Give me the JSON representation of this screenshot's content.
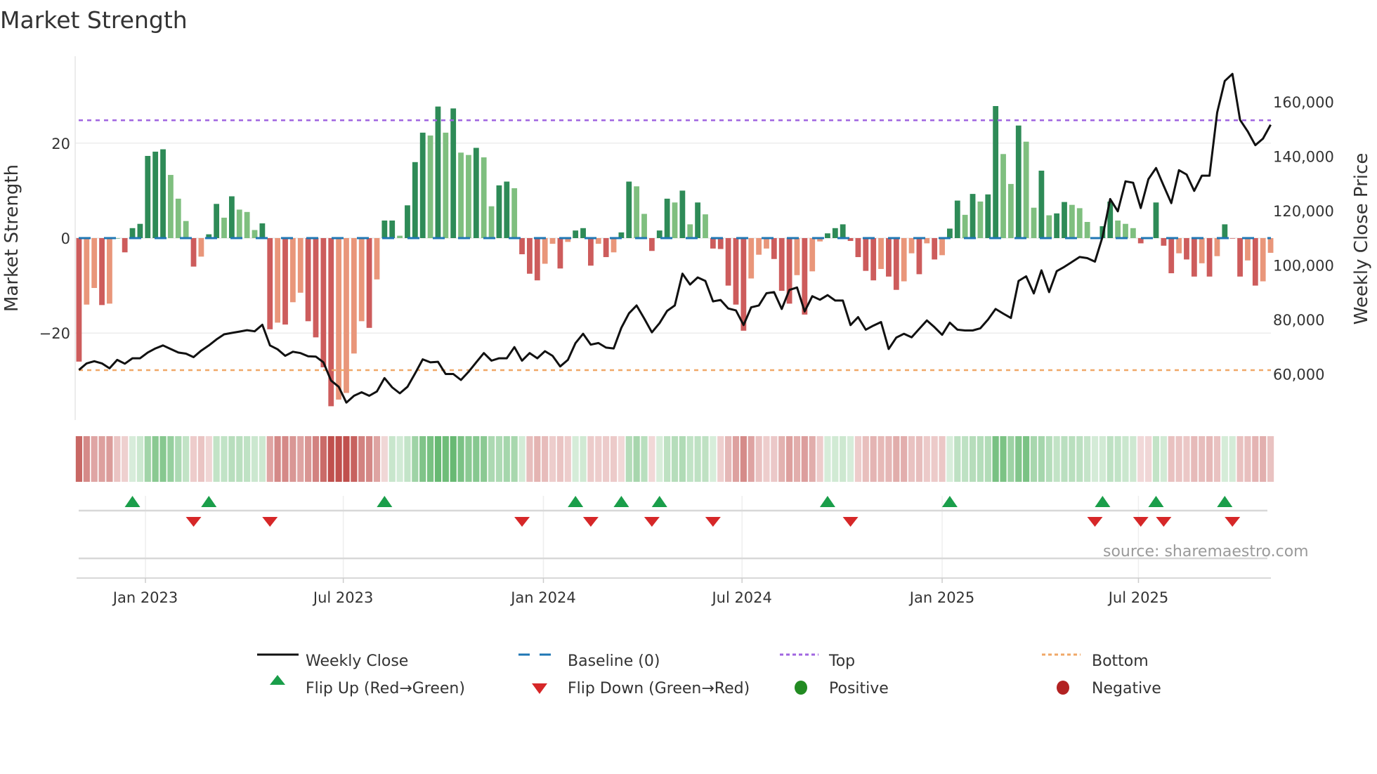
{
  "chart_data": {
    "type": "bar",
    "title": "Market Strength",
    "ylabel_left": "Market Strength",
    "ylabel_right": "Weekly Close Price",
    "ylim_left": [
      -38.3,
      38.3
    ],
    "ylim_right": [
      43100,
      176800
    ],
    "yticks_left": [
      {
        "value": 20,
        "label": "20"
      },
      {
        "value": 0,
        "label": "0"
      },
      {
        "value": -20,
        "label": "−20"
      }
    ],
    "yticks_right": [
      {
        "value": 60000,
        "label": "60,000"
      },
      {
        "value": 80000,
        "label": "80,000"
      },
      {
        "value": 100000,
        "label": "100,000"
      },
      {
        "value": 120000,
        "label": "120,000"
      },
      {
        "value": 140000,
        "label": "140,000"
      },
      {
        "value": 160000,
        "label": "160,000"
      }
    ],
    "xticks": [
      {
        "week": 9.7,
        "label": "Jan 2023"
      },
      {
        "week": 35.6,
        "label": "Jul 2023"
      },
      {
        "week": 61.8,
        "label": "Jan 2024"
      },
      {
        "week": 87.8,
        "label": "Jul 2024"
      },
      {
        "week": 114.0,
        "label": "Jan 2025"
      },
      {
        "week": 139.7,
        "label": "Jul 2025"
      }
    ],
    "top_level": 24.8,
    "bottom_level": -27.8,
    "baseline": 0,
    "strength": [
      -26.0,
      -14.0,
      -10.5,
      -14.1,
      -13.8,
      0,
      -3.0,
      2.1,
      3.0,
      17.3,
      18.2,
      18.7,
      13.3,
      8.3,
      3.6,
      -6.0,
      -3.9,
      0.8,
      7.2,
      4.3,
      8.8,
      6.0,
      5.5,
      1.7,
      3.1,
      -19.2,
      -17.8,
      -18.2,
      -13.5,
      -11.5,
      -17.5,
      -20.9,
      -27.2,
      -35.4,
      -34.0,
      -32.6,
      -24.3,
      -17.5,
      -18.9,
      -8.7,
      3.7,
      3.7,
      0.5,
      6.9,
      16.0,
      22.2,
      21.6,
      27.7,
      22.2,
      27.3,
      18.0,
      17.5,
      19.0,
      17.0,
      6.7,
      11.1,
      11.9,
      10.5,
      -3.4,
      -7.5,
      -8.9,
      -5.4,
      -1.2,
      -6.4,
      -0.8,
      1.6,
      2.1,
      -5.8,
      -1.2,
      -4.0,
      -3.0,
      1.2,
      11.9,
      10.9,
      5.1,
      -2.7,
      1.6,
      8.3,
      7.5,
      10.0,
      2.9,
      7.5,
      5.0,
      -2.2,
      -2.3,
      -10.0,
      -14.0,
      -19.5,
      -8.5,
      -3.5,
      -2.2,
      -4.4,
      -11.1,
      -13.8,
      -7.8,
      -16.1,
      -7.0,
      -0.7,
      1.0,
      2.1,
      2.9,
      -0.6,
      -4.0,
      -6.9,
      -8.9,
      -6.5,
      -8.1,
      -10.9,
      -9.1,
      -3.2,
      -7.6,
      -1.1,
      -4.5,
      -3.6,
      2.0,
      7.9,
      4.9,
      9.3,
      7.7,
      9.2,
      27.8,
      17.7,
      11.4,
      23.7,
      20.3,
      6.4,
      14.2,
      4.8,
      5.2,
      7.6,
      7.0,
      6.3,
      3.4,
      -0.1,
      2.5,
      7.7,
      3.7,
      3.0,
      2.1,
      -1.1,
      -0.2,
      7.5,
      -1.6,
      -7.4,
      -3.2,
      -4.5,
      -8.1,
      -5.3,
      -8.1,
      -3.8,
      2.9,
      -0.1,
      -8.1,
      -4.7,
      -10.0,
      -9.1,
      -3.1
    ],
    "close": [
      61500,
      63900,
      64700,
      63900,
      62100,
      65200,
      63800,
      65800,
      65800,
      67900,
      69400,
      70500,
      69200,
      67900,
      67500,
      66200,
      68600,
      70500,
      72700,
      74600,
      75100,
      75600,
      76100,
      75700,
      78100,
      70500,
      69100,
      66700,
      68200,
      67700,
      66500,
      66400,
      64300,
      57600,
      55300,
      49500,
      52000,
      53300,
      52000,
      53600,
      58500,
      55100,
      52900,
      55300,
      60200,
      65400,
      64300,
      64500,
      60000,
      60000,
      57800,
      60800,
      64300,
      67700,
      64900,
      65800,
      65800,
      69900,
      64900,
      67700,
      65800,
      68400,
      66700,
      62800,
      65200,
      71400,
      74800,
      70800,
      71400,
      69700,
      69400,
      77000,
      82300,
      85200,
      80400,
      75300,
      78700,
      83200,
      85200,
      96900,
      92900,
      95500,
      94200,
      86700,
      87200,
      84100,
      83400,
      78000,
      84500,
      85200,
      89700,
      90100,
      83900,
      90900,
      91800,
      83000,
      88600,
      87300,
      89000,
      87000,
      87000,
      78000,
      80900,
      76300,
      77800,
      79100,
      69200,
      73400,
      74800,
      73500,
      76600,
      79700,
      77200,
      74400,
      78900,
      76300,
      76000,
      76000,
      76800,
      80000,
      83900,
      82200,
      80600,
      94200,
      95900,
      89600,
      98100,
      90100,
      97800,
      99400,
      101200,
      103000,
      102600,
      101300,
      110500,
      124300,
      119800,
      130800,
      130300,
      121000,
      131600,
      135700,
      129200,
      122800,
      134900,
      133300,
      127300,
      132900,
      132900,
      156100,
      167700,
      170300,
      153400,
      149200,
      144100,
      146500,
      151600
    ],
    "colors": {
      "strong_positive": "#2e8b57",
      "weak_positive": "#7fbf7f",
      "strong_negative": "#cd5c5c",
      "weak_negative": "#e9967a",
      "close_line": "#111111",
      "baseline": "#1f77b4",
      "top": "#a066e0",
      "bottom": "#f0a868",
      "flip_up": "#1a9e4a",
      "flip_down": "#d62728",
      "positive": "#228b22",
      "negative": "#b22222"
    },
    "legend": {
      "weekly_close": "Weekly Close",
      "baseline": "Baseline (0)",
      "top": "Top",
      "bottom": "Bottom",
      "flip_up": "Flip Up (Red→Green)",
      "flip_down": "Flip Down (Green→Red)",
      "positive": "Positive",
      "negative": "Negative"
    },
    "source": "source: sharemaestro.com"
  }
}
